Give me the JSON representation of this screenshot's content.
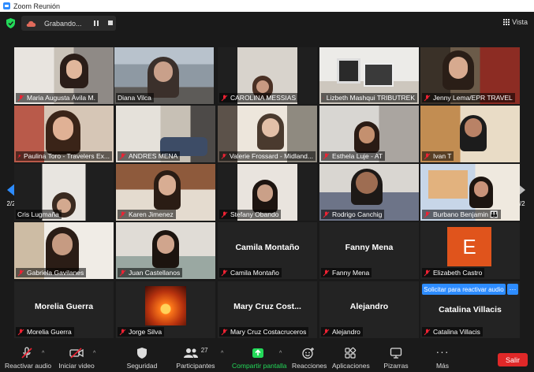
{
  "window": {
    "title": "Zoom Reunión"
  },
  "topbar": {
    "recording_label": "Grabando...",
    "view_label": "Vista"
  },
  "pagination": {
    "left": "2/2",
    "right": "2/2"
  },
  "participants": [
    {
      "name": "Maria Augusta Ávila M.",
      "muted": true,
      "video": true
    },
    {
      "name": "Diana Vilca",
      "muted": false,
      "video": true,
      "active": true
    },
    {
      "name": "CAROLINA MESSIAS",
      "muted": true,
      "video": true
    },
    {
      "name": "Lizbeth Mashqui TRIBUTREK",
      "muted": true,
      "video": true
    },
    {
      "name": "Jenny Lema/EPR TRAVEL",
      "muted": true,
      "video": true
    },
    {
      "name": "Paulina Toro - Travelers Ex...",
      "muted": true,
      "video": true
    },
    {
      "name": "ANDRES MENA",
      "muted": true,
      "video": true
    },
    {
      "name": "Valerie Frossard - Midland...",
      "muted": true,
      "video": true
    },
    {
      "name": "Esthela Luje - AT",
      "muted": true,
      "video": true
    },
    {
      "name": "Ivan T",
      "muted": true,
      "video": true
    },
    {
      "name": "Cris Lugmaña",
      "muted": false,
      "video": true
    },
    {
      "name": "Karen Jimenez",
      "muted": true,
      "video": true
    },
    {
      "name": "Stefany Obando",
      "muted": true,
      "video": true
    },
    {
      "name": "Rodrigo Canchig",
      "muted": true,
      "video": true
    },
    {
      "name": "Burbano Benjamin 👪",
      "muted": true,
      "video": true
    },
    {
      "name": "Gabriela Gavilanes",
      "muted": true,
      "video": true
    },
    {
      "name": "Juan Castellanos",
      "muted": true,
      "video": true
    },
    {
      "name": "Camila Montaño",
      "display_name": "Camila Montaño",
      "muted": true,
      "video": false
    },
    {
      "name": "Fanny Mena",
      "display_name": "Fanny Mena",
      "muted": true,
      "video": false
    },
    {
      "name": "Elizabeth Castro",
      "avatar_letter": "E",
      "muted": true,
      "video": false
    },
    {
      "name": "Morelia Guerra",
      "display_name": "Morelia Guerra",
      "muted": true,
      "video": false
    },
    {
      "name": "Jorge Silva",
      "muted": true,
      "video": false
    },
    {
      "name": "Mary Cruz Costacruceros",
      "display_name": "Mary Cruz Cost...",
      "muted": true,
      "video": false
    },
    {
      "name": "Alejandro",
      "display_name": "Alejandro",
      "muted": true,
      "video": false
    },
    {
      "name": "Catalina Villacis",
      "display_name": "Catalina Villacis",
      "muted": true,
      "video": false
    }
  ],
  "request_unmute": {
    "label": "Solicitar para reactivar audio",
    "more": "···"
  },
  "toolbar": {
    "unmute": "Reactivar audio",
    "start_video": "Iniciar video",
    "security": "Seguridad",
    "participants": "Participantes",
    "participants_count": "27",
    "share_screen": "Compartir pantalla",
    "reactions": "Reacciones",
    "apps": "Aplicaciones",
    "whiteboards": "Pizarras",
    "more": "Más",
    "leave": "Salir"
  },
  "colors": {
    "accent": "#2d8cff",
    "active_speaker": "#c8e04b",
    "leave": "#e02828",
    "share": "#23d959",
    "avatar": "#e0541c"
  }
}
